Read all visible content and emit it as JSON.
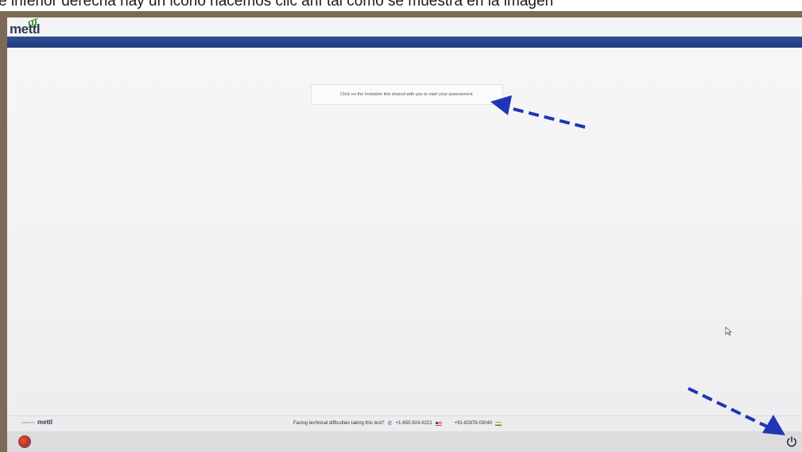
{
  "caption": {
    "text": "e inferior derecha hay un icono hacemos clic ahí tal como se muestra en la imagen"
  },
  "header": {
    "logo_text": "mettl"
  },
  "main": {
    "invite_message": "Click on the Invitation link shared with you to start your assessment."
  },
  "footer": {
    "powered_by": "powered by",
    "powered_logo": "mettl",
    "help_text": "Facing technical difficulties taking this test?",
    "phone_us": "+1-650-924-9221",
    "phone_in": "+91-82878-03040",
    "faint_text": "Mettl"
  },
  "colors": {
    "brand_bar": "#1f3c7d",
    "annotation_arrow": "#1f35b5"
  },
  "icons": {
    "phone": "phone-icon",
    "us_flag": "us-flag-icon",
    "india_flag": "india-flag-icon",
    "power": "power-icon",
    "start": "start-button-icon",
    "cursor": "mouse-cursor-icon"
  }
}
